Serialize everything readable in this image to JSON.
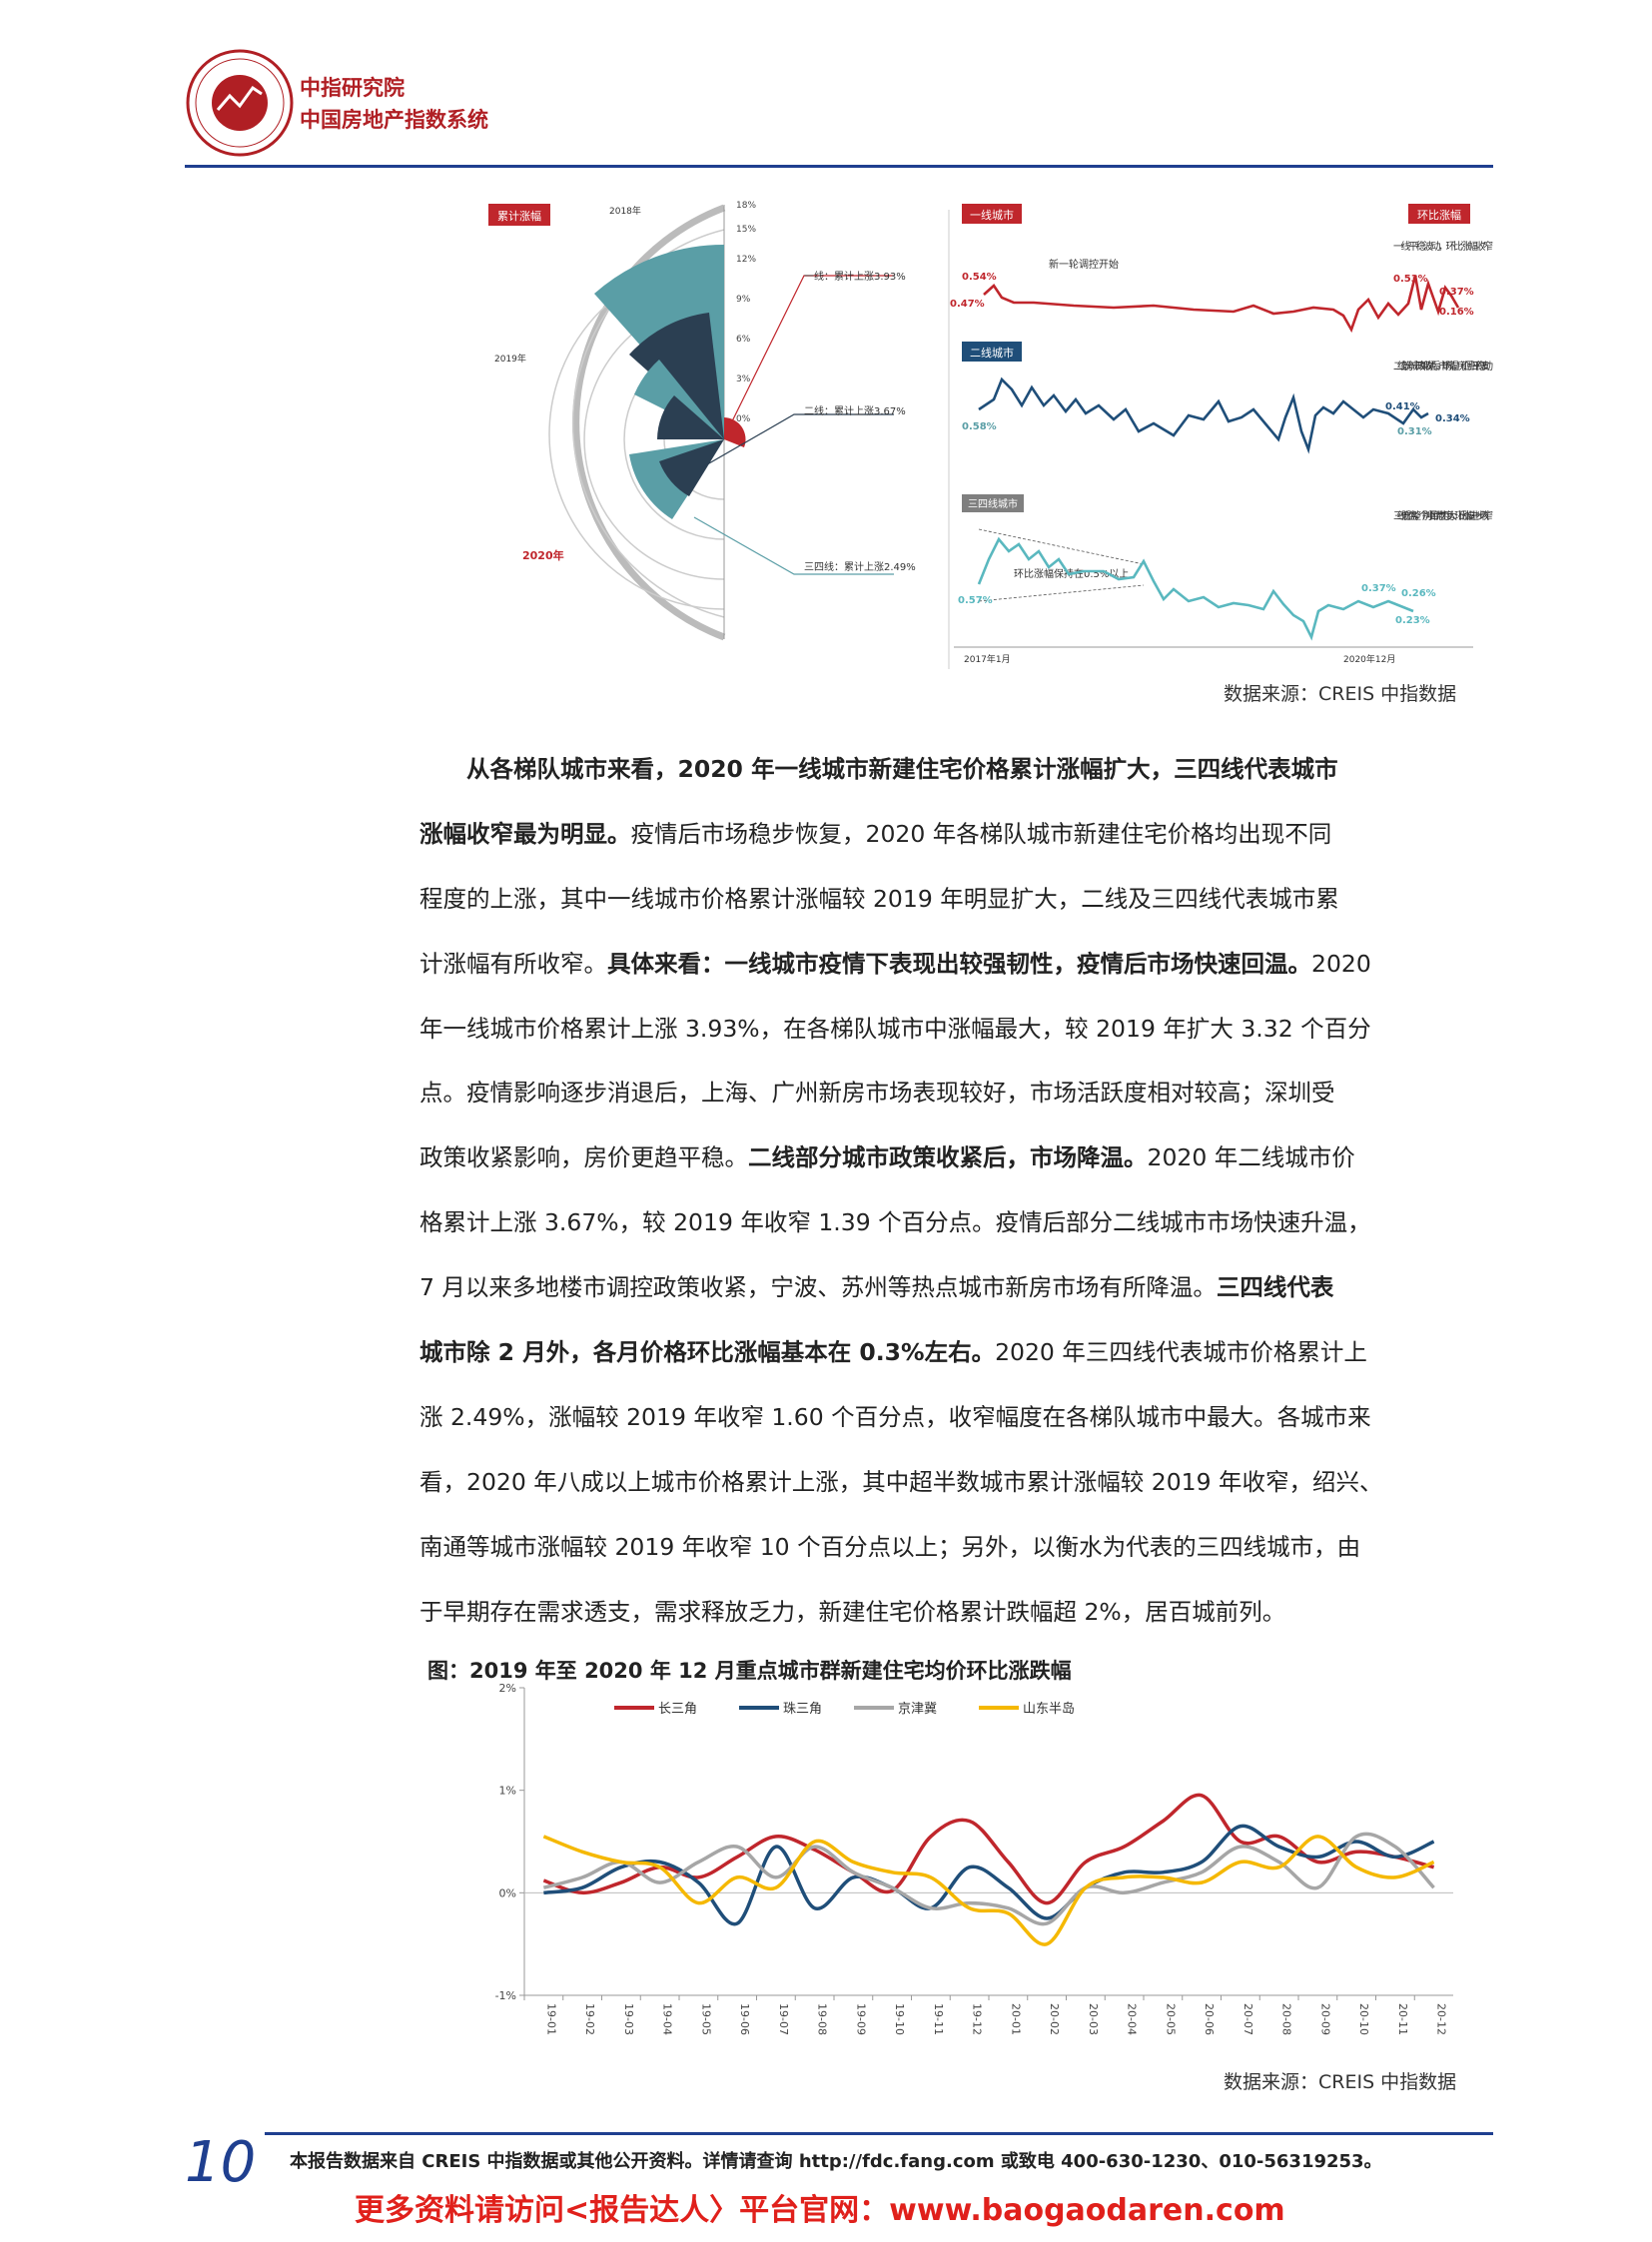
{
  "header": {
    "org_name": "中指研究院",
    "org_subtitle": "中国房地产指数系统",
    "logo_text": "中国指数研究院 CHINA INDEX ACADEMY"
  },
  "figure1": {
    "radial": {
      "badge": "累计涨幅",
      "year_labels": [
        "2018年",
        "2019年",
        "2020年"
      ],
      "ticks": [
        "18%",
        "15%",
        "12%",
        "9%",
        "6%",
        "3%",
        "0%"
      ],
      "callouts": [
        "一线：累计上涨3.93%",
        "二线：累计上涨3.67%",
        "三四线：累计上涨2.49%"
      ]
    },
    "right": {
      "badge_mom": "环比涨幅",
      "panel1": {
        "tag": "一线城市",
        "note_left": "新一轮调控开始",
        "note_right": "一线平稳波动，环比涨幅收窄",
        "values": [
          "0.54%",
          "0.47%",
          "0.53%",
          "0.37%",
          "0.16%"
        ]
      },
      "panel2": {
        "tag": "二线城市",
        "note_right": "二线部分城市政策收紧后，市场降温，房价回归平稳波动",
        "values": [
          "0.58%",
          "0.41%",
          "0.34%",
          "0.31%"
        ]
      },
      "panel3": {
        "tag": "三四线城市",
        "note_mid": "环比涨幅保持在0.5%以上",
        "note_right": "三线低位盘整，个别项目优惠力度大，环比涨幅进一步收窄",
        "values": [
          "0.57%",
          "0.37%",
          "0.26%",
          "0.23%"
        ],
        "x_start": "2017年1月",
        "x_end": "2020年12月"
      }
    },
    "source": "数据来源：CREIS 中指数据"
  },
  "body": {
    "lines": [
      {
        "b": "从各梯队城市来看，2020 年一线城市新建住宅价格累计涨幅扩大，三四线代表城市",
        "n": ""
      },
      {
        "b": "涨幅收窄最为明显。",
        "n": "疫情后市场稳步恢复，2020 年各梯队城市新建住宅价格均出现不同"
      },
      {
        "b": "",
        "n": "程度的上涨，其中一线城市价格累计涨幅较 2019 年明显扩大，二线及三四线代表城市累"
      },
      {
        "b": "",
        "n": "计涨幅有所收窄。",
        "b2": "具体来看：一线城市疫情下表现出较强韧性，疫情后市场快速回温。",
        "n2": "2020"
      },
      {
        "b": "",
        "n": "年一线城市价格累计上涨 3.93%，在各梯队城市中涨幅最大，较 2019 年扩大 3.32 个百分"
      },
      {
        "b": "",
        "n": "点。疫情影响逐步消退后，上海、广州新房市场表现较好，市场活跃度相对较高；深圳受"
      },
      {
        "b": "",
        "n": "政策收紧影响，房价更趋平稳。",
        "b2": "二线部分城市政策收紧后，市场降温。",
        "n2": "2020 年二线城市价"
      },
      {
        "b": "",
        "n": "格累计上涨 3.67%，较 2019 年收窄 1.39 个百分点。疫情后部分二线城市市场快速升温，"
      },
      {
        "b": "",
        "n": "7 月以来多地楼市调控政策收紧，宁波、苏州等热点城市新房市场有所降温。",
        "b2": "三四线代表"
      },
      {
        "b": "城市除 2 月外，各月价格环比涨幅基本在 0.3%左右。",
        "n": "2020 年三四线代表城市价格累计上"
      },
      {
        "b": "",
        "n": "涨 2.49%，涨幅较 2019 年收窄 1.60 个百分点，收窄幅度在各梯队城市中最大。各城市来"
      },
      {
        "b": "",
        "n": "看，2020 年八成以上城市价格累计上涨，其中超半数城市累计涨幅较 2019 年收窄，绍兴、"
      },
      {
        "b": "",
        "n": "南通等城市涨幅较 2019 年收窄 10 个百分点以上；另外，以衡水为代表的三四线城市，由"
      },
      {
        "b": "",
        "n": "于早期存在需求透支，需求释放乏力，新建住宅价格累计跌幅超 2%，居百城前列。"
      }
    ]
  },
  "figure2": {
    "caption": "图：2019 年至 2020 年 12 月重点城市群新建住宅均价环比涨跌幅",
    "source": "数据来源：CREIS 中指数据"
  },
  "chart_data": {
    "type": "line",
    "title": "2019 年至 2020 年 12 月重点城市群新建住宅均价环比涨跌幅",
    "x": [
      "19-01",
      "19-02",
      "19-03",
      "19-04",
      "19-05",
      "19-06",
      "19-07",
      "19-08",
      "19-09",
      "19-10",
      "19-11",
      "19-12",
      "20-01",
      "20-02",
      "20-03",
      "20-04",
      "20-05",
      "20-06",
      "20-07",
      "20-08",
      "20-09",
      "20-10",
      "20-11",
      "20-12"
    ],
    "ylim": [
      -1,
      2
    ],
    "yticks": [
      "2%",
      "1%",
      "0%",
      "-1%"
    ],
    "legend_position": "top",
    "series": [
      {
        "name": "长三角",
        "color": "#c0262c",
        "values": [
          0.12,
          0.0,
          0.1,
          0.25,
          0.15,
          0.35,
          0.55,
          0.42,
          0.2,
          0.02,
          0.55,
          0.7,
          0.3,
          -0.1,
          0.3,
          0.45,
          0.7,
          0.95,
          0.5,
          0.55,
          0.3,
          0.4,
          0.35,
          0.25
        ]
      },
      {
        "name": "珠三角",
        "color": "#1f4e79",
        "values": [
          0.0,
          0.05,
          0.25,
          0.3,
          0.1,
          -0.3,
          0.45,
          -0.15,
          0.15,
          0.05,
          -0.15,
          0.25,
          0.05,
          -0.25,
          0.05,
          0.2,
          0.2,
          0.3,
          0.65,
          0.45,
          0.35,
          0.5,
          0.35,
          0.5
        ]
      },
      {
        "name": "京津冀",
        "color": "#a6a6a6",
        "values": [
          0.05,
          0.15,
          0.3,
          0.1,
          0.3,
          0.45,
          0.15,
          0.45,
          0.2,
          0.05,
          -0.15,
          -0.1,
          -0.15,
          -0.3,
          0.05,
          0.0,
          0.1,
          0.2,
          0.45,
          0.3,
          0.05,
          0.55,
          0.45,
          0.05
        ]
      },
      {
        "name": "山东半岛",
        "color": "#f5b800",
        "values": [
          0.55,
          0.4,
          0.3,
          0.25,
          -0.1,
          0.15,
          0.05,
          0.5,
          0.3,
          0.2,
          0.15,
          -0.15,
          -0.2,
          -0.5,
          0.05,
          0.15,
          0.15,
          0.1,
          0.3,
          0.25,
          0.55,
          0.25,
          0.15,
          0.3
        ]
      }
    ]
  },
  "footer": {
    "page_number": "10",
    "note": "本报告数据来自 CREIS 中指数据或其他公开资料。详情请查询 http://fdc.fang.com 或致电 400-630-1230、010-56319253。",
    "promo": "更多资料请访问<报告达人〉平台官网：www.baogaodaren.com"
  }
}
